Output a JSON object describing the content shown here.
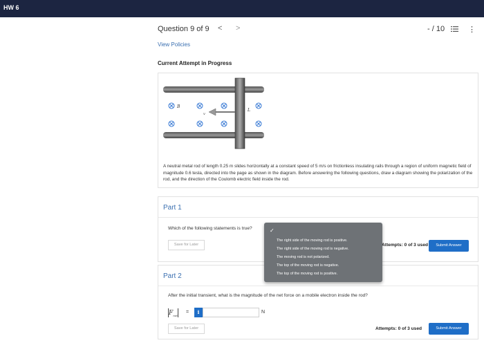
{
  "app": {
    "title": "HW 6"
  },
  "header": {
    "question_label": "Question 9 of 9",
    "prev_glyph": "<",
    "next_glyph": ">",
    "score": "- / 10",
    "more_glyph": "⋮"
  },
  "links": {
    "view_policies": "View Policies"
  },
  "status": {
    "attempt": "Current Attempt in Progress"
  },
  "problem": {
    "diagram_labels": {
      "field": "B",
      "velocity": "v",
      "length": "L"
    },
    "description": "A neutral metal rod of length 0.25 m slides horizontally at a constant speed of 5 m/s on frictionless insulating rails through a region of uniform magnetic field of magnitude 0.6 tesla, directed into the page as shown in the diagram. Before answering the following questions, draw a diagram showing the polarization of the rod, and the direction of the Coulomb electric field inside the rod."
  },
  "part1": {
    "title": "Part 1",
    "question": "Which of the following statements is true?",
    "save_label": "Save for Later",
    "attempts": "Attempts: 0 of 3 used",
    "submit_label": "Submit Answer",
    "dropdown": {
      "check": "✓",
      "options": [
        "The right side of the moving rod is positive.",
        "The right side of the moving rod is negative.",
        "The moving rod is not polarized.",
        "The top of the moving rod is negative.",
        "The top of the moving rod is positive."
      ]
    }
  },
  "part2": {
    "title": "Part 2",
    "question": "After the initial transient, what is the magnitude of the net force on a mobile electron inside the rod?",
    "formula_symbol": "F",
    "formula_sub": "net",
    "equals": "=",
    "info_glyph": "i",
    "answer_value": "",
    "unit": "N",
    "save_label": "Save for Later",
    "attempts": "Attempts: 0 of 3 used",
    "submit_label": "Submit Answer"
  },
  "colors": {
    "topbar": "#1c2541",
    "accent": "#1f6ec7",
    "link": "#3a6fb0",
    "dropdown_bg": "#6e7276",
    "field_symbol": "#3a7bd5"
  },
  "icons": {
    "list": "list-icon",
    "more": "kebab-menu-icon",
    "field": "into-page-field-icon"
  }
}
